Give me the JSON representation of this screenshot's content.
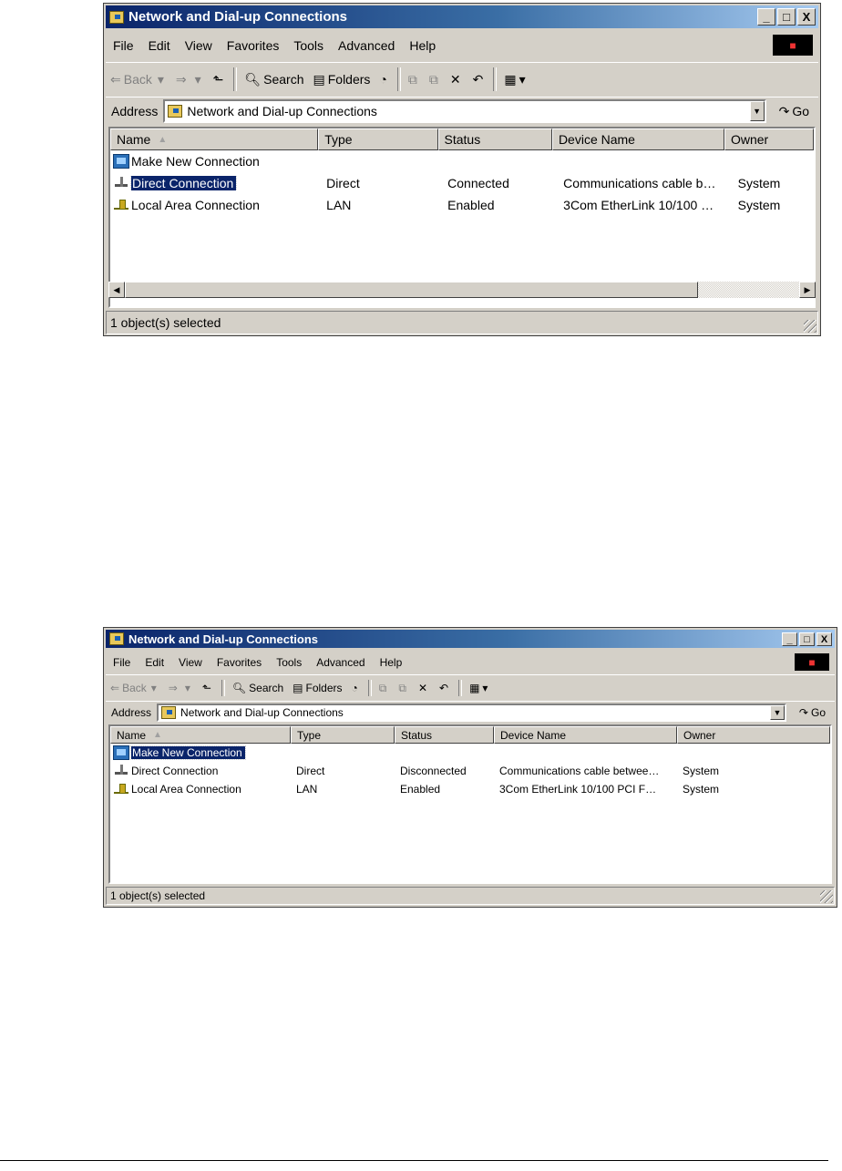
{
  "colors": {
    "titlebar_start": "#0a246a",
    "titlebar_end": "#a6caf0",
    "selection": "#0a246a",
    "face": "#d4d0c8"
  },
  "windows": [
    {
      "title": "Network and Dial-up Connections",
      "caption": {
        "minimize": "_",
        "maximize": "□",
        "close": "X"
      },
      "menu": [
        "File",
        "Edit",
        "View",
        "Favorites",
        "Tools",
        "Advanced",
        "Help"
      ],
      "toolbar": {
        "back": "Back",
        "search": "Search",
        "folders": "Folders"
      },
      "address": {
        "label": "Address",
        "value": "Network and Dial-up Connections",
        "go": "Go"
      },
      "columns": [
        "Name",
        "Type",
        "Status",
        "Device Name",
        "Owner"
      ],
      "rows": [
        {
          "icon": "new-connection-icon",
          "name": "Make New Connection",
          "type": "",
          "status": "",
          "device": "",
          "owner": ""
        },
        {
          "icon": "direct-cable-icon",
          "name": "Direct Connection",
          "type": "Direct",
          "status": "Connected",
          "device": "Communications cable b…",
          "owner": "System",
          "selected": true
        },
        {
          "icon": "lan-icon",
          "name": "Local Area Connection",
          "type": "LAN",
          "status": "Enabled",
          "device": "3Com EtherLink 10/100 …",
          "owner": "System"
        }
      ],
      "status": "1 object(s) selected"
    },
    {
      "title": "Network and Dial-up Connections",
      "caption": {
        "minimize": "_",
        "maximize": "□",
        "close": "X"
      },
      "menu": [
        "File",
        "Edit",
        "View",
        "Favorites",
        "Tools",
        "Advanced",
        "Help"
      ],
      "toolbar": {
        "back": "Back",
        "search": "Search",
        "folders": "Folders"
      },
      "address": {
        "label": "Address",
        "value": "Network and Dial-up Connections",
        "go": "Go"
      },
      "columns": [
        "Name",
        "Type",
        "Status",
        "Device Name",
        "Owner"
      ],
      "rows": [
        {
          "icon": "new-connection-icon",
          "name": "Make New Connection",
          "type": "",
          "status": "",
          "device": "",
          "owner": "",
          "selected": true
        },
        {
          "icon": "direct-cable-icon",
          "name": "Direct Connection",
          "type": "Direct",
          "status": "Disconnected",
          "device": "Communications cable betwee…",
          "owner": "System"
        },
        {
          "icon": "lan-icon",
          "name": "Local Area Connection",
          "type": "LAN",
          "status": "Enabled",
          "device": "3Com EtherLink 10/100 PCI F…",
          "owner": "System"
        }
      ],
      "status": "1 object(s) selected"
    }
  ]
}
